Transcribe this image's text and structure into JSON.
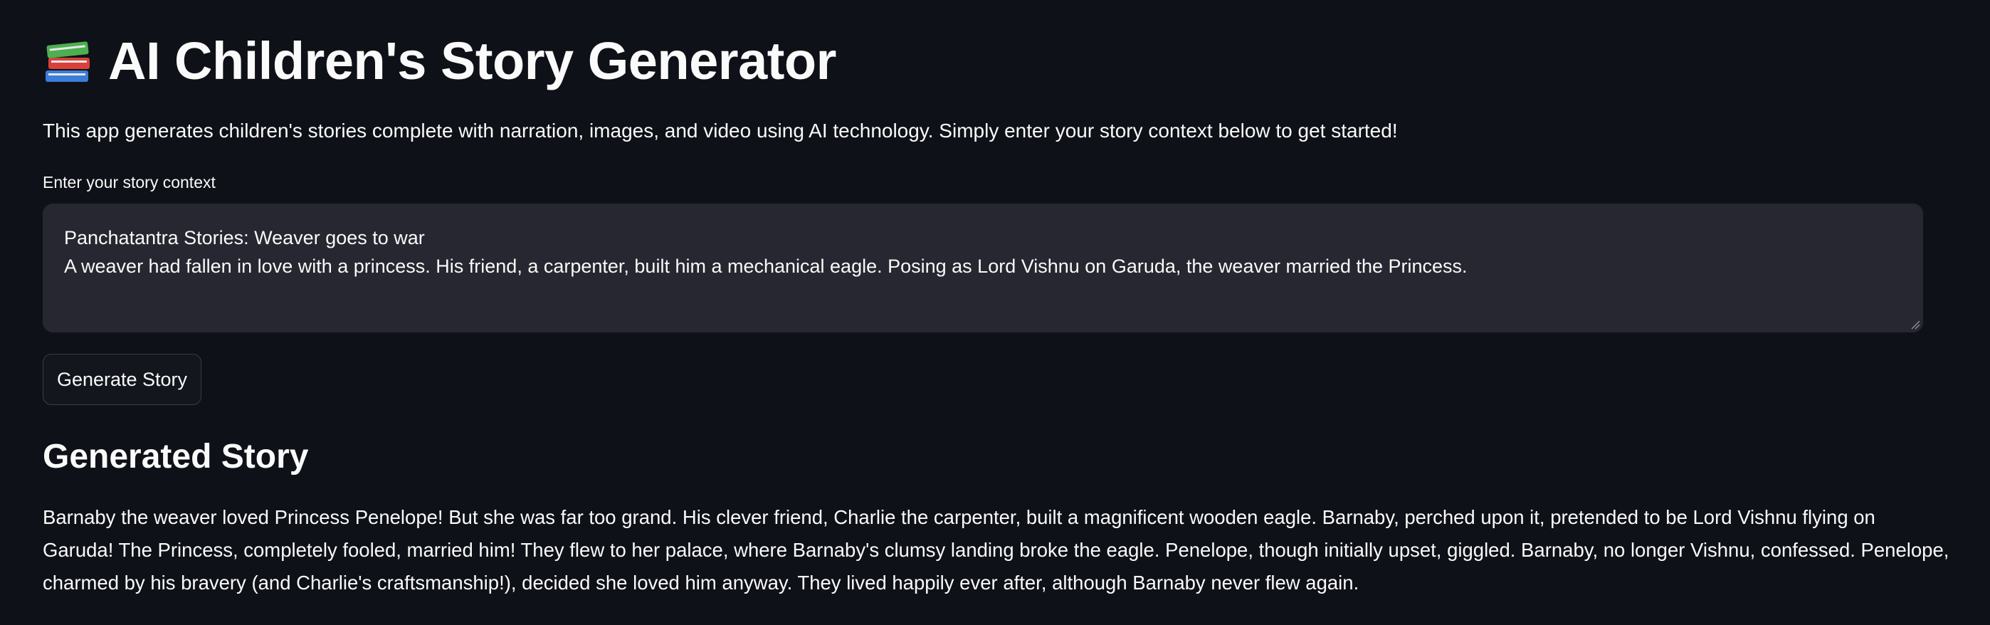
{
  "header": {
    "icon": "books-icon",
    "title": "AI Children's Story Generator"
  },
  "intro": {
    "text": "This app generates children's stories complete with narration, images, and video using AI technology. Simply enter your story context below to get started!"
  },
  "context_input": {
    "label": "Enter your story context",
    "value": "Panchatantra Stories: Weaver goes to war\nA weaver had fallen in love with a princess. His friend, a carpenter, built him a mechanical eagle. Posing as Lord Vishnu on Garuda, the weaver married the Princess."
  },
  "actions": {
    "generate_label": "Generate Story"
  },
  "result": {
    "heading": "Generated Story",
    "story": "Barnaby the weaver loved Princess Penelope! But she was far too grand. His clever friend, Charlie the carpenter, built a magnificent wooden eagle. Barnaby, perched upon it, pretended to be Lord Vishnu flying on Garuda! The Princess, completely fooled, married him! They flew to her palace, where Barnaby's clumsy landing broke the eagle. Penelope, though initially upset, giggled. Barnaby, no longer Vishnu, confessed. Penelope, charmed by his bravery (and Charlie's craftsmanship!), decided she loved him anyway. They lived happily ever after, although Barnaby never flew again."
  },
  "colors": {
    "background": "#0e1117",
    "text": "#fafafa",
    "input_background": "#262730",
    "button_border": "#3a3d47"
  }
}
